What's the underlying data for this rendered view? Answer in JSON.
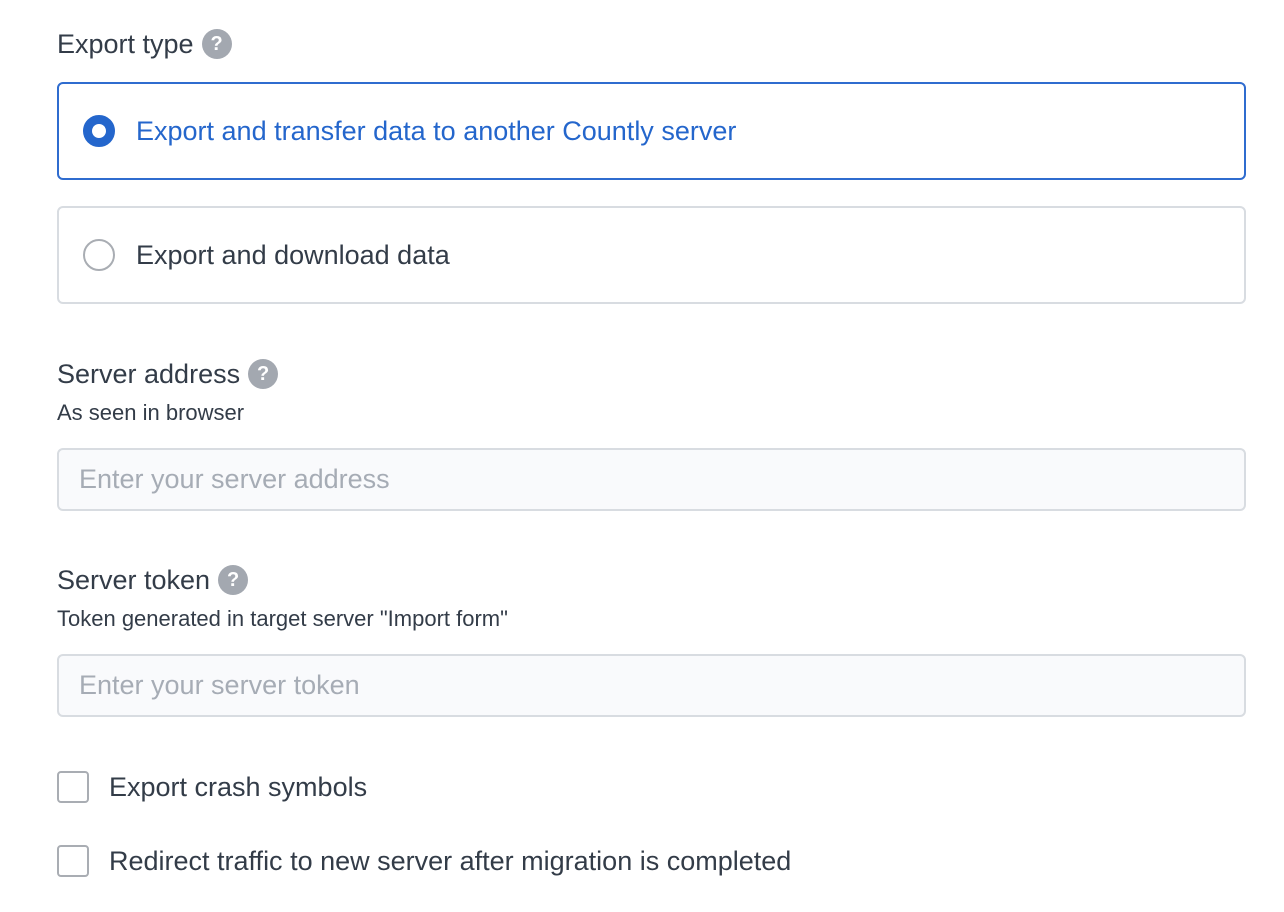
{
  "export_type": {
    "label": "Export type",
    "help": "?",
    "options": [
      {
        "label": "Export and transfer data to another Countly server",
        "selected": true
      },
      {
        "label": "Export and download data",
        "selected": false
      }
    ]
  },
  "server_address": {
    "label": "Server address",
    "help": "?",
    "hint": "As seen in browser",
    "placeholder": "Enter your server address",
    "value": ""
  },
  "server_token": {
    "label": "Server token",
    "help": "?",
    "hint": "Token generated in target server \"Import form\"",
    "placeholder": "Enter your server token",
    "value": ""
  },
  "checkboxes": [
    {
      "label": "Export crash symbols",
      "checked": false
    },
    {
      "label": "Redirect traffic to new server after migration is completed",
      "checked": false
    }
  ],
  "colors": {
    "accent": "#2466cc",
    "text": "#333c48",
    "border": "#d8dce1",
    "help_icon": "#a3a8b0"
  }
}
